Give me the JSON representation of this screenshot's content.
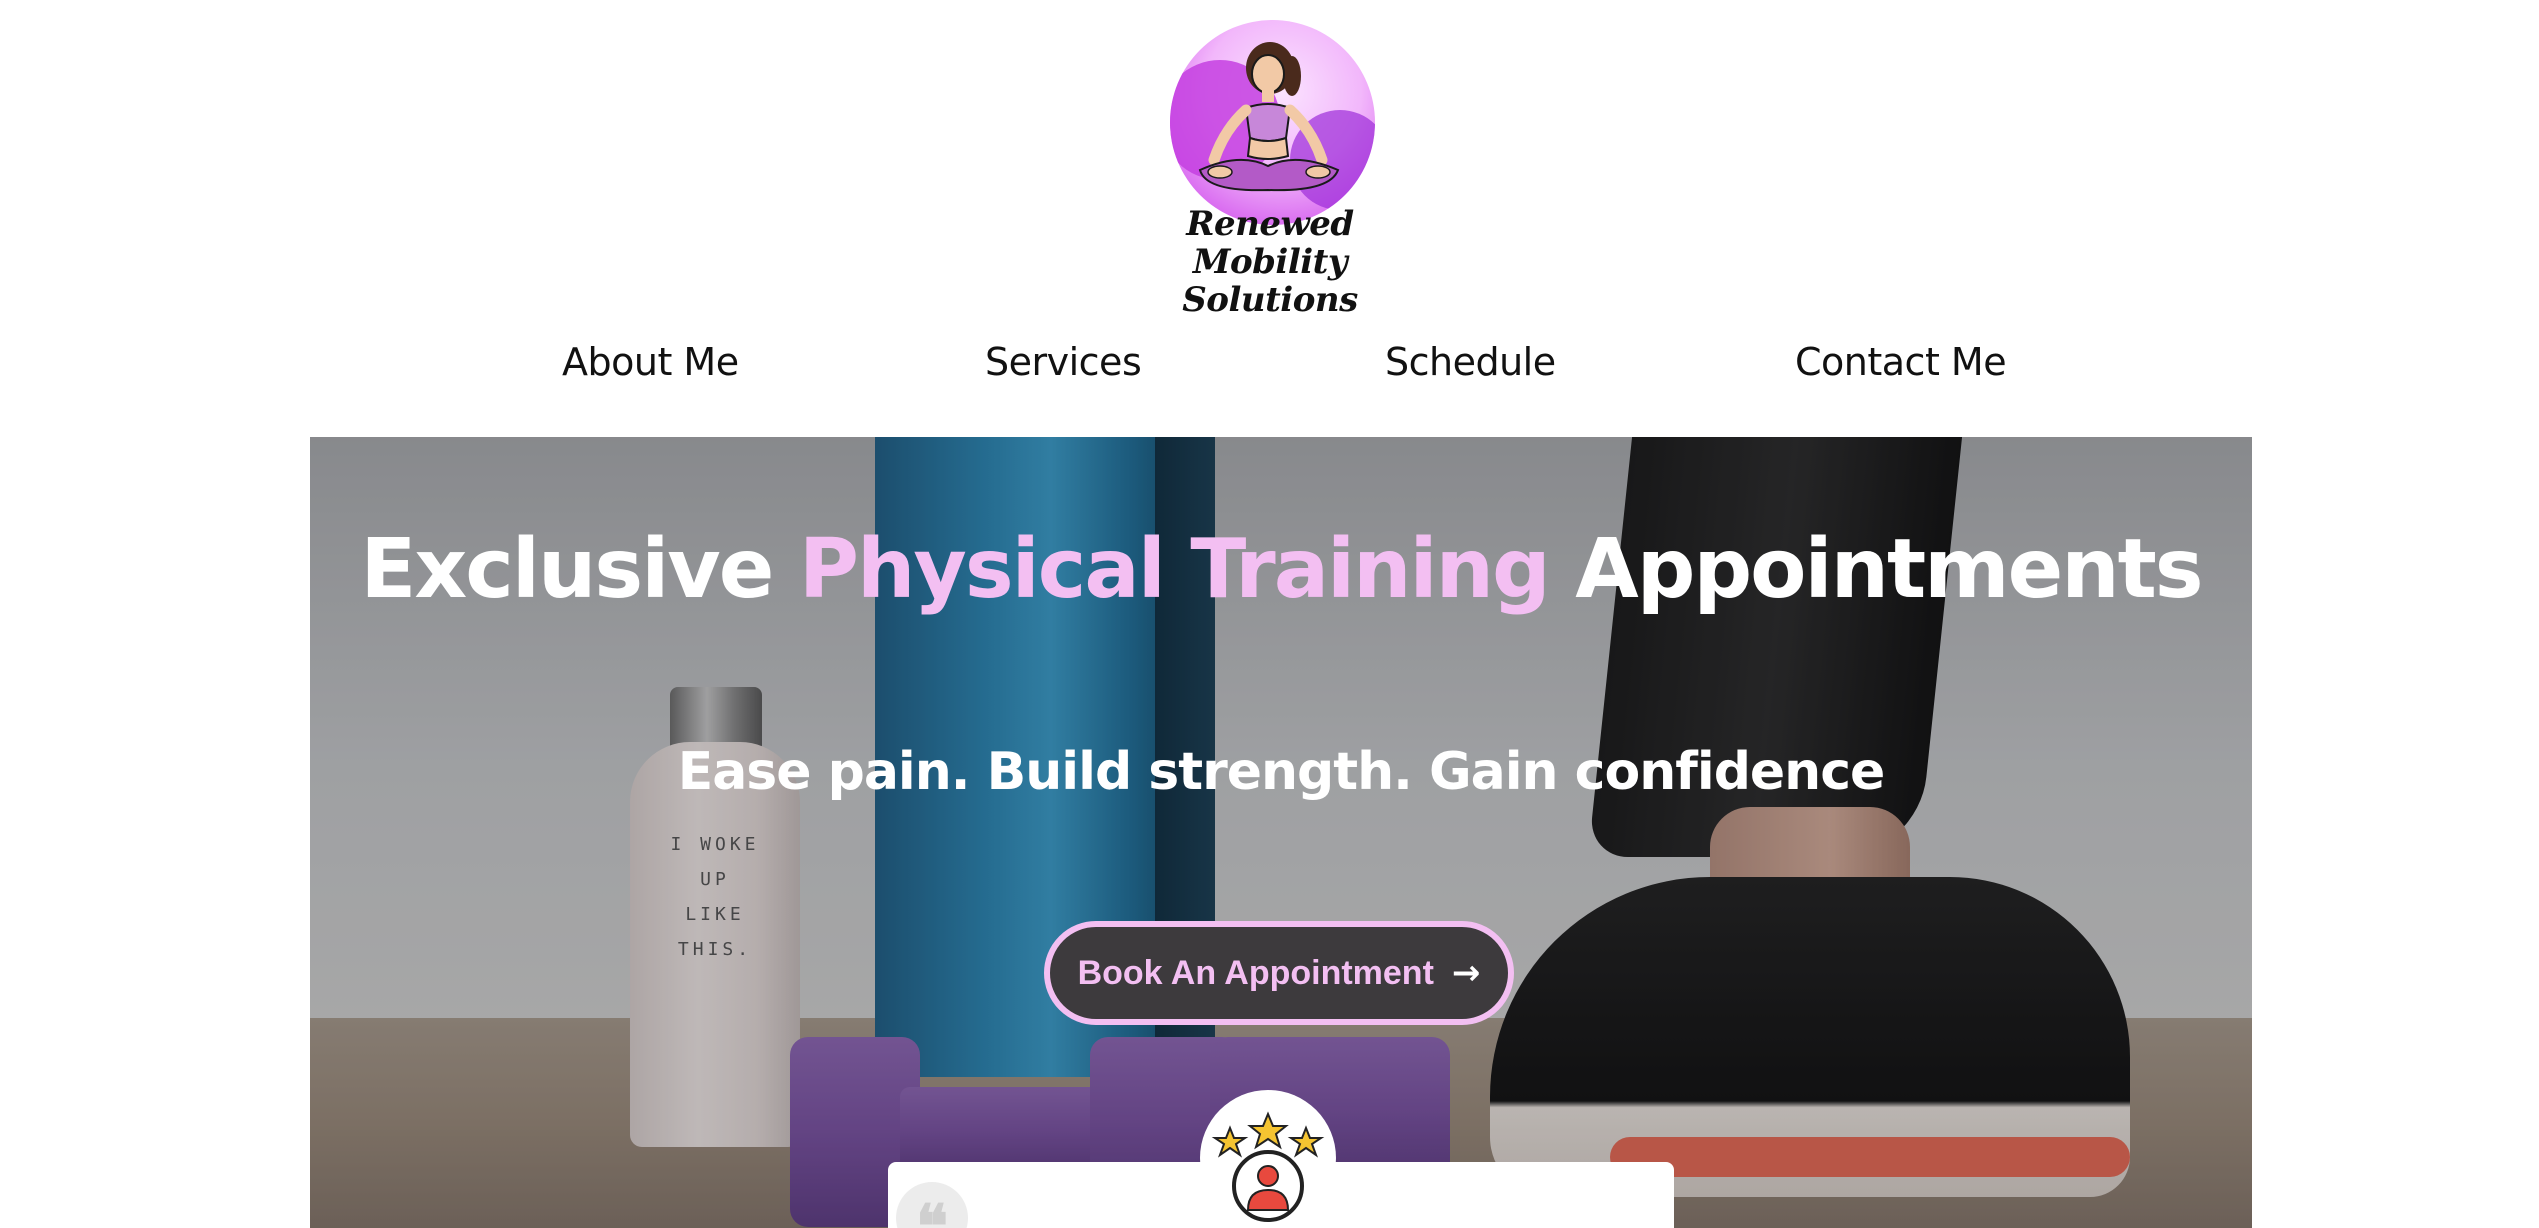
{
  "brand": {
    "logo_text_line1": "Renewed Mobility",
    "logo_text_line2": "Solutions"
  },
  "nav": {
    "items": [
      {
        "label": "About Me"
      },
      {
        "label": "Services"
      },
      {
        "label": "Schedule"
      },
      {
        "label": "Contact Me"
      }
    ]
  },
  "hero": {
    "title_part1": "Exclusive ",
    "title_accent": "Physical Training",
    "title_part2": " Appointments",
    "subtitle": "Ease pain. Build strength. Gain confidence",
    "cta_label": "Book An Appointment",
    "cta_icon": "arrow-right-icon",
    "bottle_text": "I WOKE UP LIKE THIS."
  },
  "review": {
    "quote_icon": "quote-icon",
    "avatar_icon": "star-rating-user-icon"
  },
  "colors": {
    "accent_pink": "#f3bff2",
    "button_bg": "#3d3a3d",
    "text_dark": "#111111",
    "logo_purple": "#c43fe0"
  }
}
